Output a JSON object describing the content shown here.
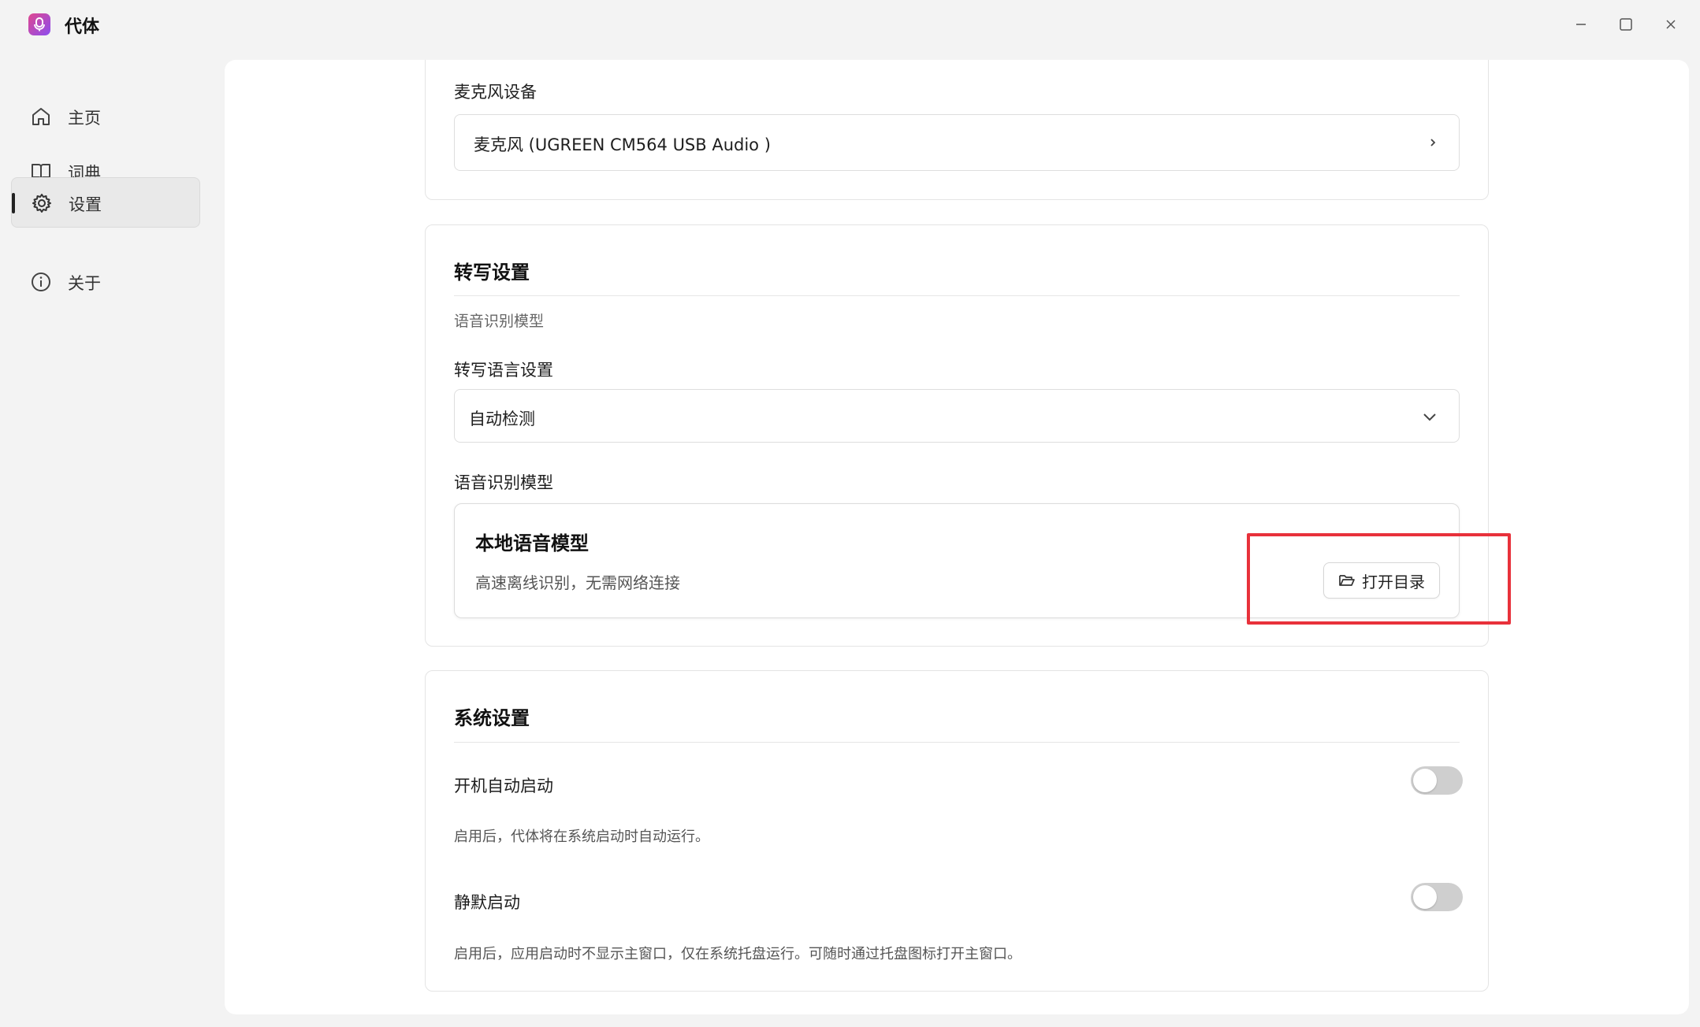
{
  "app": {
    "title": "代体"
  },
  "window_controls": [
    "minimize-icon",
    "maximize-icon",
    "close-icon"
  ],
  "sidebar": {
    "items": [
      {
        "label": "主页",
        "icon": "home-icon",
        "active": false
      },
      {
        "label": "词典",
        "icon": "book-icon",
        "active": false
      },
      {
        "label": "设置",
        "icon": "gear-icon",
        "active": true
      },
      {
        "label": "关于",
        "icon": "info-icon",
        "active": false
      }
    ]
  },
  "microphone": {
    "label": "麦克风设备",
    "value": "麦克风 (UGREEN CM564 USB Audio )"
  },
  "transcription": {
    "title": "转写设置",
    "subtitle": "语音识别模型",
    "language_label": "转写语言设置",
    "language_value": "自动检测",
    "model_label": "语音识别模型",
    "model": {
      "title": "本地语音模型",
      "description": "高速离线识别，无需网络连接",
      "open_button": "打开目录"
    }
  },
  "system": {
    "title": "系统设置",
    "autostart": {
      "label": "开机自动启动",
      "hint": "启用后，代体将在系统启动时自动运行。",
      "enabled": false
    },
    "silent": {
      "label": "静默启动",
      "hint": "启用后，应用启动时不显示主窗口，仅在系统托盘运行。可随时通过托盘图标打开主窗口。",
      "enabled": false
    }
  },
  "colors": {
    "highlight": "#e8313b",
    "toggle_off": "#cfcfcf",
    "active_bar": "#222222"
  }
}
